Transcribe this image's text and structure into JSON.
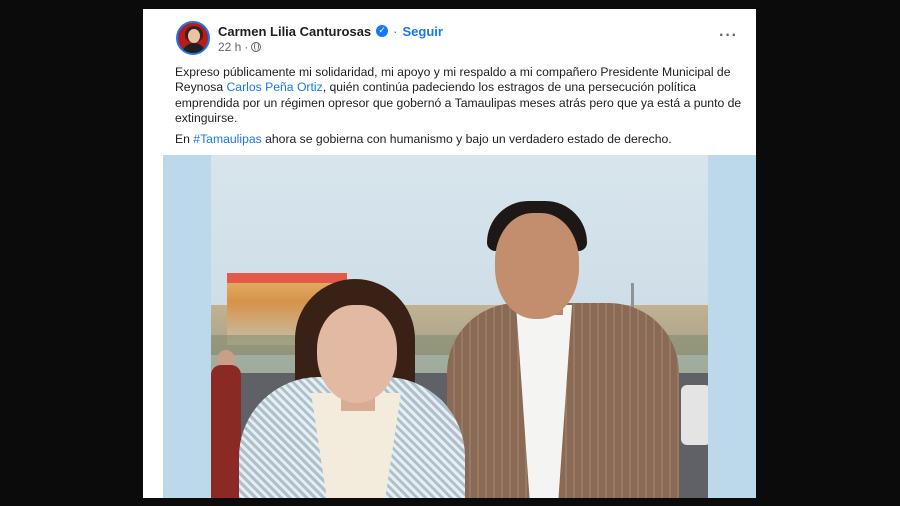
{
  "post": {
    "author": "Carmen Lilia Canturosas",
    "separator": "·",
    "follow_label": "Seguir",
    "time": "22 h",
    "time_separator": "·",
    "more_label": "···",
    "verified_glyph": "✓",
    "paragraph1": {
      "before_link": "Expreso públicamente mi solidaridad, mi apoyo y mi respaldo a mi compañero Presidente Municipal de Reynosa ",
      "link": "Carlos Peña Ortiz",
      "after_link": ", quién continúa padeciendo los estragos de una persecución política emprendida por un régimen opresor que gobernó a Tamaulipas meses atrás pero que ya está a punto de extinguirse."
    },
    "paragraph2": {
      "before_link": "En ",
      "hashtag": "#Tamaulipas",
      "after_link": " ahora se gobierna con humanismo y bajo un verdadero estado de derecho."
    }
  },
  "icons": {
    "verified": "verified-badge-icon",
    "privacy": "globe-icon",
    "menu": "more-options-icon"
  },
  "colors": {
    "link": "#1877f2",
    "text": "#1c1e21",
    "secondary": "#65676b",
    "photo_frame": "#bcd9ec",
    "backdrop": "#0b0b0b"
  }
}
